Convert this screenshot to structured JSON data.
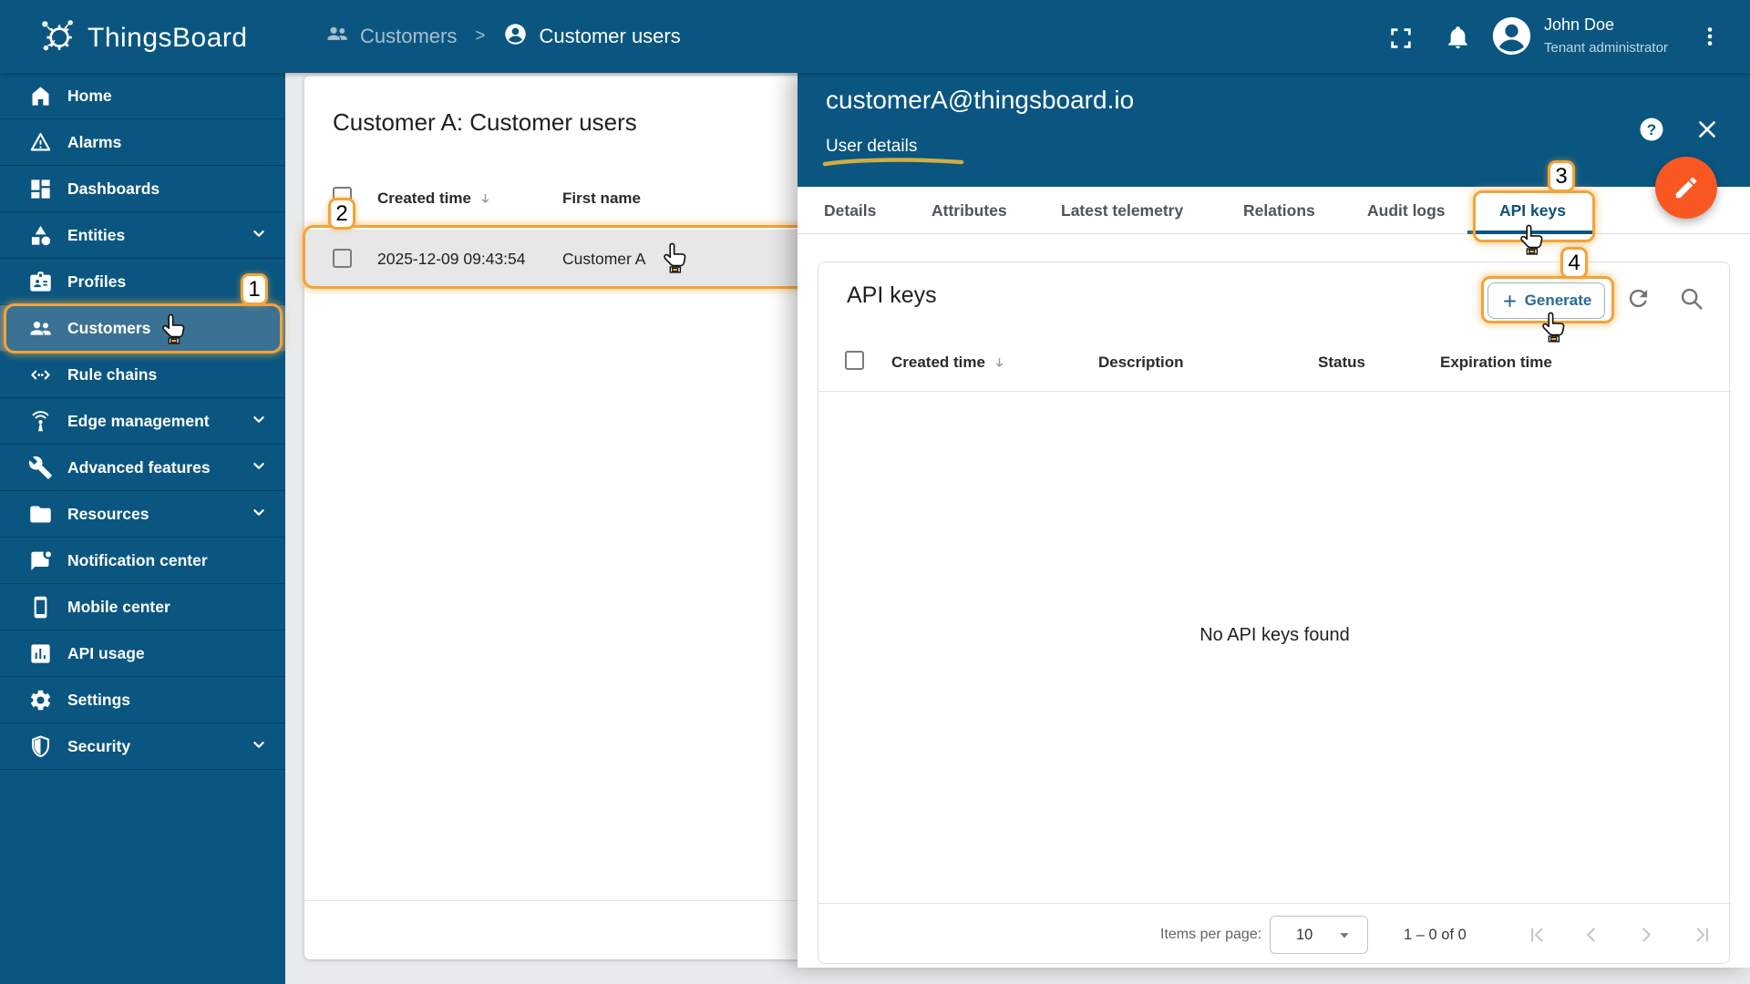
{
  "colors": {
    "primary_blue": "#0a5680",
    "selected_item_bg": "#3b7294",
    "fab_orange": "#f95822",
    "annotation_amber": "#f3a33a",
    "link_blue": "#2a6a9b",
    "page_bg": "#e9eaeb",
    "row_highlight": "#e7e7e7"
  },
  "header": {
    "logo_text": "ThingsBoard",
    "breadcrumb": {
      "parent": "Customers",
      "separator": ">",
      "current": "Customer users"
    },
    "user": {
      "name": "John Doe",
      "role": "Tenant administrator"
    }
  },
  "sidebar": {
    "items": [
      {
        "label": "Home",
        "icon": "home-icon"
      },
      {
        "label": "Alarms",
        "icon": "alarm-triangle-icon"
      },
      {
        "label": "Dashboards",
        "icon": "dashboard-icon"
      },
      {
        "label": "Entities",
        "icon": "shapes-icon",
        "expandable": true
      },
      {
        "label": "Profiles",
        "icon": "badge-icon"
      },
      {
        "label": "Customers",
        "icon": "people-icon",
        "selected": true
      },
      {
        "label": "Rule chains",
        "icon": "rule-chain-icon"
      },
      {
        "label": "Edge management",
        "icon": "antenna-icon",
        "expandable": true
      },
      {
        "label": "Advanced features",
        "icon": "wrench-icon",
        "expandable": true
      },
      {
        "label": "Resources",
        "icon": "folder-icon",
        "expandable": true
      },
      {
        "label": "Notification center",
        "icon": "notification-bubble-icon"
      },
      {
        "label": "Mobile center",
        "icon": "phone-icon"
      },
      {
        "label": "API usage",
        "icon": "chart-box-icon"
      },
      {
        "label": "Settings",
        "icon": "gear-icon"
      },
      {
        "label": "Security",
        "icon": "shield-icon",
        "expandable": true
      }
    ]
  },
  "users_panel": {
    "title": "Customer A: Customer users",
    "columns": {
      "created_time": "Created time",
      "first_name": "First name"
    },
    "rows": [
      {
        "created_time": "2025-12-09 09:43:54",
        "first_name": "Customer A"
      }
    ]
  },
  "detail_panel": {
    "title": "customerA@thingsboard.io",
    "subtitle": "User details",
    "tabs": [
      "Details",
      "Attributes",
      "Latest telemetry",
      "Relations",
      "Audit logs",
      "API keys"
    ],
    "active_tab": "API keys",
    "api_keys": {
      "title": "API keys",
      "generate_button": "Generate",
      "columns": {
        "created_time": "Created time",
        "description": "Description",
        "status": "Status",
        "expiration_time": "Expiration time"
      },
      "empty_message": "No API keys found",
      "pagination": {
        "items_per_page_label": "Items per page:",
        "page_size": "10",
        "range": "1 – 0 of 0"
      }
    }
  },
  "annotations": {
    "badge1": "1",
    "badge2": "2",
    "badge3": "3",
    "badge4": "4"
  },
  "icons": [
    "fullscreen-icon",
    "bell-icon",
    "avatar-icon",
    "kebab-menu-icon",
    "help-icon",
    "close-icon",
    "pencil-icon",
    "refresh-icon",
    "search-icon",
    "plus-icon",
    "sort-desc-icon",
    "dropdown-caret-icon",
    "first-page-icon",
    "prev-page-icon",
    "next-page-icon",
    "last-page-icon",
    "hand-cursor-icon"
  ]
}
